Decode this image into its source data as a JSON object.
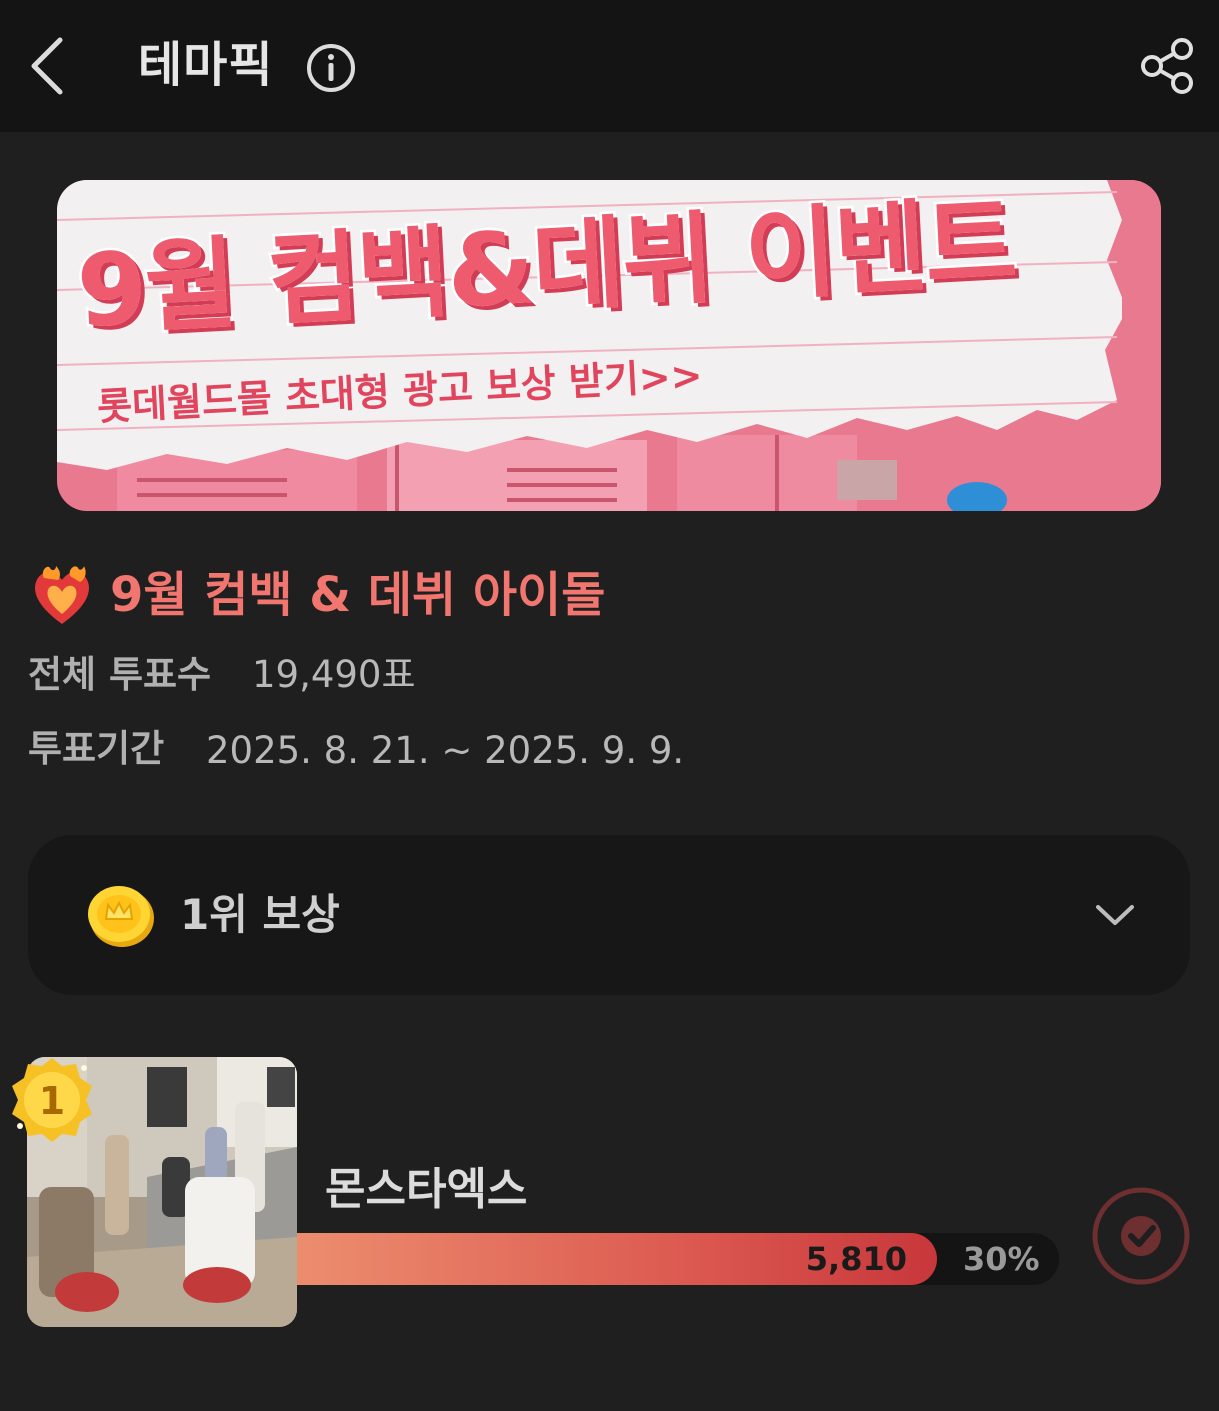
{
  "header": {
    "title": "테마픽",
    "back_icon": "chevron-left-icon",
    "info_icon": "info-icon",
    "share_icon": "share-icon"
  },
  "banner": {
    "headline": "9월 컴백&데뷔 이벤트",
    "subline": "롯데월드몰 초대형 광고 보상 받기>>",
    "accent_color": "#ee5a6e"
  },
  "vote": {
    "icon": "heart-on-fire-icon",
    "title": "9월 컴백 & 데뷔 아이돌",
    "total_votes_label": "전체 투표수",
    "total_votes_value": "19,490표",
    "period_label": "투표기간",
    "period_value": "2025. 8. 21. ~ 2025. 9. 9.",
    "title_color": "#f0766f"
  },
  "reward": {
    "icon": "coin-icon",
    "label": "1위 보상",
    "expand_icon": "chevron-down-icon"
  },
  "candidates": [
    {
      "rank": "1",
      "name": "몬스타엑스",
      "votes": "5,810",
      "percent": "30%",
      "bar_fraction": 0.84,
      "action_icon": "check-circle-icon"
    }
  ]
}
